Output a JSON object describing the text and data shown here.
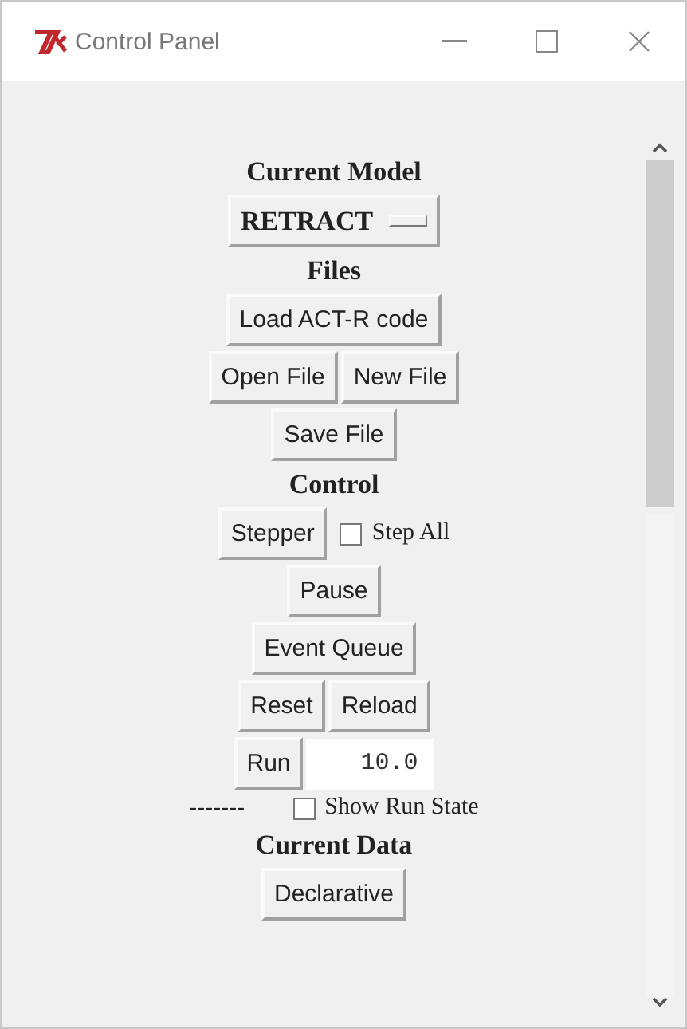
{
  "window": {
    "title": "Control Panel"
  },
  "sections": [
    {
      "title": "Current Model",
      "rows": [
        [
          {
            "kind": "menubutton",
            "label": "RETRACT"
          }
        ]
      ]
    },
    {
      "title": "Files",
      "rows": [
        [
          {
            "kind": "button",
            "label": "Load ACT-R code"
          }
        ],
        [
          {
            "kind": "button",
            "label": "Open File"
          },
          {
            "kind": "button",
            "label": "New File"
          }
        ],
        [
          {
            "kind": "button",
            "label": "Save File"
          }
        ]
      ]
    },
    {
      "title": "Control",
      "rows": [
        [
          {
            "kind": "button",
            "label": "Stepper"
          },
          {
            "kind": "checkbox",
            "label": "Step All",
            "checked": false
          }
        ],
        [
          {
            "kind": "button",
            "label": "Pause"
          }
        ],
        [
          {
            "kind": "button",
            "label": "Event Queue"
          }
        ],
        [
          {
            "kind": "button",
            "label": "Reset"
          },
          {
            "kind": "button",
            "label": "Reload"
          }
        ],
        [
          {
            "kind": "button",
            "label": "Run"
          },
          {
            "kind": "entry",
            "value": "10.0"
          }
        ],
        [
          {
            "kind": "label",
            "label": "-------"
          },
          {
            "kind": "checkbox",
            "label": "Show Run State",
            "checked": false
          }
        ]
      ]
    },
    {
      "title": "Current Data",
      "rows": [
        [
          {
            "kind": "button",
            "label": "Declarative"
          }
        ]
      ]
    }
  ]
}
